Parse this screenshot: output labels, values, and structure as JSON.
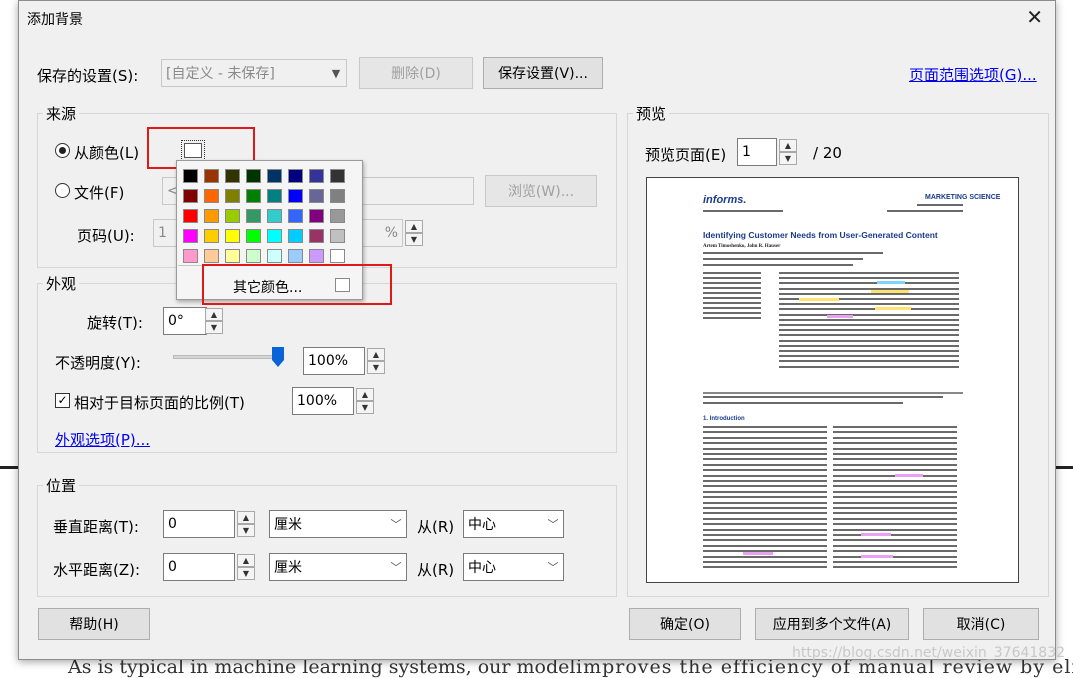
{
  "dialog": {
    "title": "添加背景",
    "close_glyph": "✕",
    "saved_settings": {
      "label": "保存的设置(S):",
      "value": "[自定义 - 未保存]",
      "delete_label": "删除(D)",
      "save_label": "保存设置(V)..."
    },
    "page_range_link": "页面范围选项(G)...",
    "source": {
      "group_label": "来源",
      "from_color_label": "从颜色(L)",
      "from_file_label": "文件(F)",
      "file_value": "<",
      "browse_label": "浏览(W)...",
      "page_label": "页码(U):",
      "page_value": "1",
      "scale_value": "%"
    },
    "color_palette": {
      "other_colors_label": "其它颜色...",
      "colors": [
        [
          "#000000",
          "#993300",
          "#333300",
          "#003300",
          "#003366",
          "#000080",
          "#333399",
          "#333333"
        ],
        [
          "#800000",
          "#ff6600",
          "#808000",
          "#008000",
          "#008080",
          "#0000ff",
          "#666699",
          "#808080"
        ],
        [
          "#ff0000",
          "#ff9900",
          "#99cc00",
          "#339966",
          "#33cccc",
          "#3366ff",
          "#800080",
          "#999999"
        ],
        [
          "#ff00ff",
          "#ffcc00",
          "#ffff00",
          "#00ff00",
          "#00ffff",
          "#00ccff",
          "#993366",
          "#c0c0c0"
        ],
        [
          "#ff99cc",
          "#ffcc99",
          "#ffff99",
          "#ccffcc",
          "#ccffff",
          "#99ccff",
          "#cc99ff",
          "#ffffff"
        ]
      ]
    },
    "appearance": {
      "group_label": "外观",
      "rotation_label": "旋转(T):",
      "rotation_value": "0°",
      "opacity_label": "不透明度(Y):",
      "opacity_value": "100%",
      "opacity_level": 1.0,
      "relative_scale_label": "相对于目标页面的比例(T)",
      "relative_scale_checked": true,
      "relative_scale_value": "100%",
      "appearance_options_link": "外观选项(P)..."
    },
    "position": {
      "group_label": "位置",
      "vertical_label": "垂直距离(T):",
      "vertical_value": "0",
      "vertical_unit": "厘米",
      "vertical_from_label": "从(R)",
      "vertical_from_value": "中心",
      "horizontal_label": "水平距离(Z):",
      "horizontal_value": "0",
      "horizontal_unit": "厘米",
      "horizontal_from_label": "从(R)",
      "horizontal_from_value": "中心"
    },
    "preview": {
      "group_label": "预览",
      "page_label": "预览页面(E)",
      "page_value": "1",
      "page_total": "/ 20",
      "doc": {
        "logo": "informs.",
        "journal": "MARKETING SCIENCE",
        "article_title": "Identifying Customer Needs from User-Generated Content",
        "authors": "Artem Timoshenko, John R. Hauser",
        "section_heading": "1. Introduction"
      }
    },
    "footer": {
      "help_label": "帮助(H)",
      "ok_label": "确定(O)",
      "apply_multi_label": "应用到多个文件(A)",
      "cancel_label": "取消(C)"
    }
  },
  "background_doc": {
    "bottom_text_left": "As is typical in machine learning systems, our model",
    "bottom_text_right": "improves the efficiency of manual review by elimi-",
    "watermark": "https://blog.csdn.net/weixin_37641832"
  }
}
